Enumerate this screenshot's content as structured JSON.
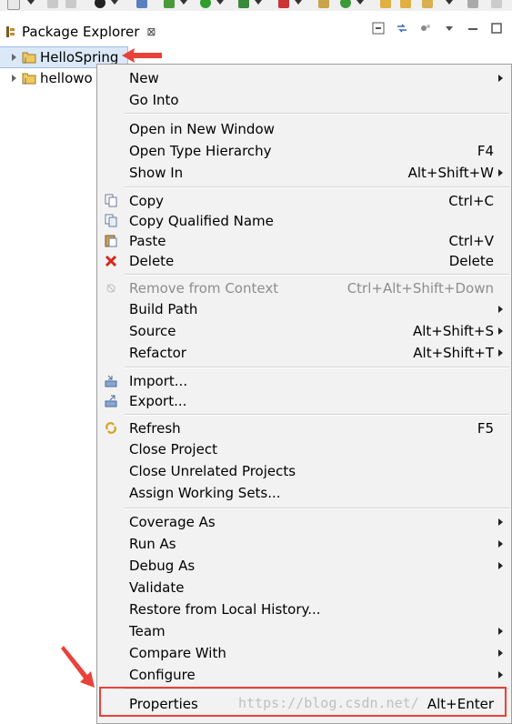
{
  "view": {
    "title": "Package Explorer",
    "close_glyph": "⊠"
  },
  "tree": {
    "items": [
      {
        "label": "HelloSpring"
      },
      {
        "label": "hellowo"
      }
    ]
  },
  "menu": {
    "items": [
      {
        "label": "New",
        "accel": "",
        "sub": true
      },
      {
        "label": "Go Into",
        "accel": ""
      },
      {
        "label": "Open in New Window",
        "accel": ""
      },
      {
        "label": "Open Type Hierarchy",
        "accel": "F4"
      },
      {
        "label": "Show In",
        "accel": "Alt+Shift+W",
        "sub": true
      },
      {
        "label": "Copy",
        "accel": "Ctrl+C",
        "icon": "copy-icon"
      },
      {
        "label": "Copy Qualified Name",
        "accel": "",
        "icon": "copy-qualified-icon"
      },
      {
        "label": "Paste",
        "accel": "Ctrl+V",
        "icon": "paste-icon"
      },
      {
        "label": "Delete",
        "accel": "Delete",
        "icon": "delete-icon"
      },
      {
        "label": "Remove from Context",
        "accel": "Ctrl+Alt+Shift+Down",
        "disabled": true,
        "icon": "remove-context-icon"
      },
      {
        "label": "Build Path",
        "accel": "",
        "sub": true
      },
      {
        "label": "Source",
        "accel": "Alt+Shift+S",
        "sub": true
      },
      {
        "label": "Refactor",
        "accel": "Alt+Shift+T",
        "sub": true
      },
      {
        "label": "Import...",
        "accel": "",
        "icon": "import-icon"
      },
      {
        "label": "Export...",
        "accel": "",
        "icon": "export-icon"
      },
      {
        "label": "Refresh",
        "accel": "F5",
        "icon": "refresh-icon"
      },
      {
        "label": "Close Project",
        "accel": ""
      },
      {
        "label": "Close Unrelated Projects",
        "accel": ""
      },
      {
        "label": "Assign Working Sets...",
        "accel": ""
      },
      {
        "label": "Coverage As",
        "accel": "",
        "sub": true
      },
      {
        "label": "Run As",
        "accel": "",
        "sub": true
      },
      {
        "label": "Debug As",
        "accel": "",
        "sub": true
      },
      {
        "label": "Validate",
        "accel": ""
      },
      {
        "label": "Restore from Local History...",
        "accel": ""
      },
      {
        "label": "Team",
        "accel": "",
        "sub": true
      },
      {
        "label": "Compare With",
        "accel": "",
        "sub": true
      },
      {
        "label": "Configure",
        "accel": "",
        "sub": true
      },
      {
        "label": "Properties",
        "accel": "Alt+Enter"
      }
    ]
  },
  "watermark": "https://blog.csdn.net/",
  "colors": {
    "annotation_red": "#e8423a",
    "menu_bg": "#f2f2f2",
    "selection": "#dbe8f7"
  }
}
